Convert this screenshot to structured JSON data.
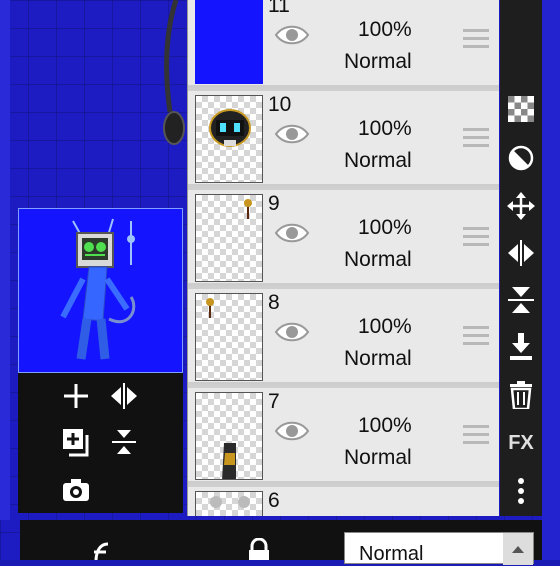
{
  "layers": [
    {
      "number": "11",
      "opacity": "100%",
      "blend": "Normal",
      "thumb": "solid-blue"
    },
    {
      "number": "10",
      "opacity": "100%",
      "blend": "Normal",
      "thumb": "robot-head"
    },
    {
      "number": "9",
      "opacity": "100%",
      "blend": "Normal",
      "thumb": "pin-top-right"
    },
    {
      "number": "8",
      "opacity": "100%",
      "blend": "Normal",
      "thumb": "pin-top-left"
    },
    {
      "number": "7",
      "opacity": "100%",
      "blend": "Normal",
      "thumb": "bottom-stroke"
    },
    {
      "number": "6",
      "opacity": "",
      "blend": "",
      "thumb": "partial"
    }
  ],
  "right_toolbar": {
    "fx_label": "FX",
    "icons": [
      "transparency-icon",
      "invert-icon",
      "move-icon",
      "flip-horizontal-icon",
      "flip-vertical-icon",
      "merge-down-icon",
      "delete-icon",
      "fx-icon",
      "more-icon"
    ]
  },
  "left_tools": {
    "icons": [
      "add-layer-icon",
      "flip-icon",
      "duplicate-layer-icon",
      "merge-icon",
      "camera-icon"
    ]
  },
  "bottom_bar": {
    "blend_mode_value": "Normal",
    "icons": [
      "clipping-icon",
      "lock-icon",
      "dropdown-arrow-icon"
    ]
  },
  "colors": {
    "canvas_blue": "#1c1cc2",
    "layer_blue": "#1414ff",
    "panel_bg": "#e9e9e9",
    "toolbar_bg": "#1e1e1e"
  }
}
